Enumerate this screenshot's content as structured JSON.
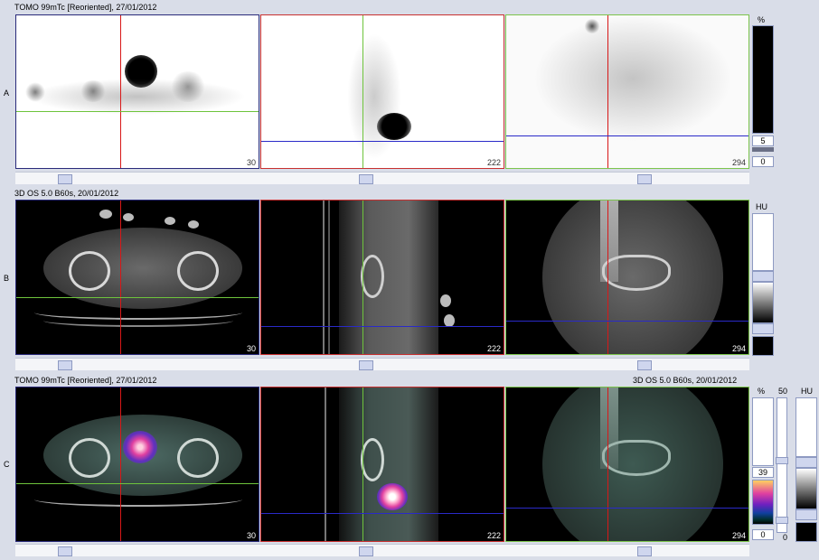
{
  "rows": {
    "a": {
      "label": "A",
      "header_left": "TOMO 99mTc [Reoriented], 27/01/2012",
      "slices": [
        "30",
        "222",
        "294"
      ],
      "scale_unit": "%",
      "scale_value": "5",
      "scale_min": "0"
    },
    "b": {
      "label": "B",
      "header_left": "3D  OS  5.0  B60s, 20/01/2012",
      "slices": [
        "30",
        "222",
        "294"
      ],
      "scale_unit": "HU"
    },
    "c": {
      "label": "C",
      "header_left": "TOMO 99mTc [Reoriented], 27/01/2012",
      "header_right": "3D  OS  5.0  B60s, 20/01/2012",
      "slices": [
        "30",
        "222",
        "294"
      ],
      "scale_unit_pct": "%",
      "scale_top": "50",
      "scale_unit_hu": "HU",
      "scale_value": "39",
      "scale_min": "0",
      "scale_min_right": "0"
    }
  },
  "colors": {
    "crosshair_red": "#d81818",
    "crosshair_green": "#6ec43c",
    "crosshair_blue": "#2a2ac8",
    "frame_navy": "#2a2a7a",
    "frame_red": "#c83030",
    "frame_green": "#7cc44c",
    "app_bg": "#d9dde8"
  }
}
